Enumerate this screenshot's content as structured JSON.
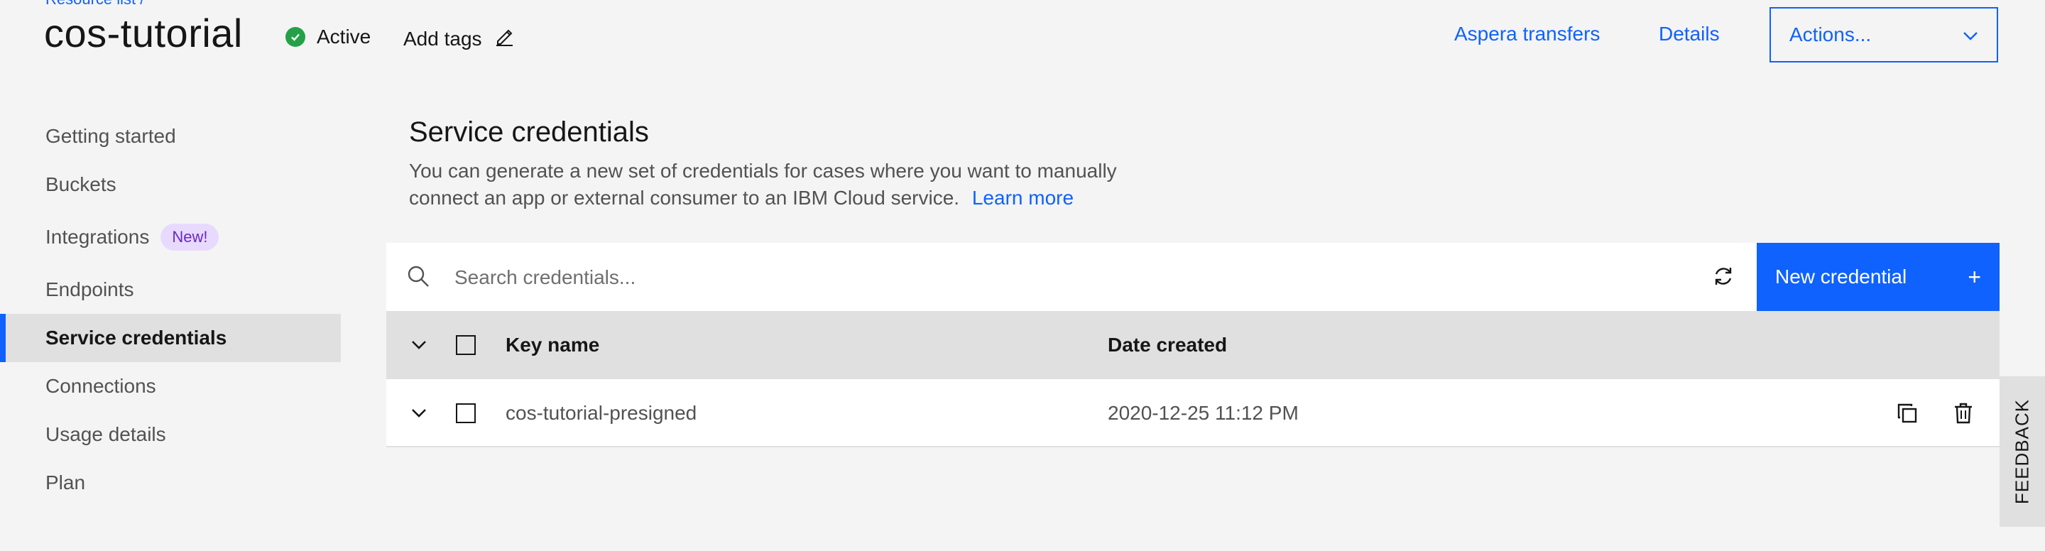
{
  "breadcrumb": {
    "label": "Resource list  /"
  },
  "header": {
    "title": "cos-tutorial",
    "status": "Active",
    "add_tags": "Add tags",
    "links": [
      "Aspera transfers",
      "Details"
    ],
    "actions_label": "Actions..."
  },
  "sidebar": {
    "items": [
      {
        "label": "Getting started"
      },
      {
        "label": "Buckets"
      },
      {
        "label": "Integrations",
        "tag": "New!"
      },
      {
        "label": "Endpoints"
      },
      {
        "label": "Service credentials",
        "active": true
      },
      {
        "label": "Connections"
      },
      {
        "label": "Usage details"
      },
      {
        "label": "Plan"
      }
    ]
  },
  "main": {
    "title": "Service credentials",
    "description": "You can generate a new set of credentials for cases where you want to manually connect an app or external consumer to an IBM Cloud service.",
    "learn_more": "Learn more",
    "search_placeholder": "Search credentials...",
    "new_credential": "New credential",
    "table": {
      "headers": [
        "Key name",
        "Date created"
      ],
      "rows": [
        {
          "key_name": "cos-tutorial-presigned",
          "date_created": "2020-12-25 11:12 PM"
        }
      ]
    }
  },
  "feedback": "FEEDBACK",
  "colors": {
    "primary": "#0f62fe",
    "success": "#24a148",
    "tag_bg": "#e8daff",
    "tag_text": "#6929c4"
  }
}
